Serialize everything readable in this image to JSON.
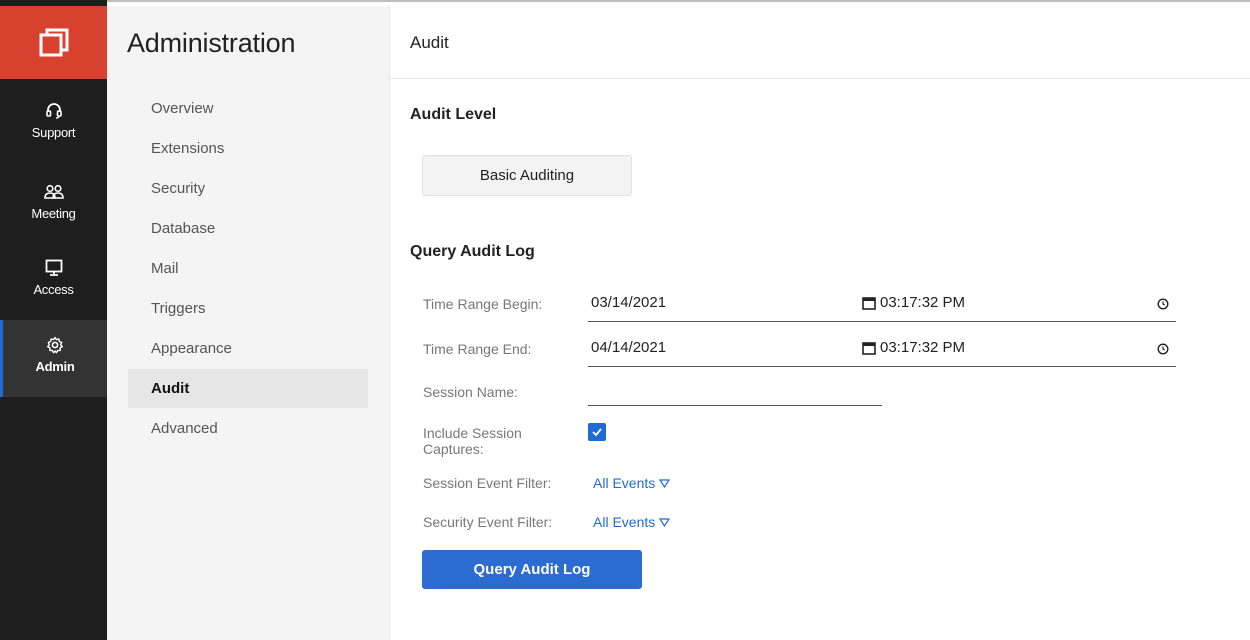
{
  "rail": {
    "items": [
      {
        "label": "Support",
        "icon": "headset-icon"
      },
      {
        "label": "Meeting",
        "icon": "people-icon"
      },
      {
        "label": "Access",
        "icon": "monitor-icon"
      },
      {
        "label": "Admin",
        "icon": "gear-icon",
        "active": true
      }
    ]
  },
  "nav": {
    "title": "Administration",
    "items": [
      {
        "label": "Overview"
      },
      {
        "label": "Extensions"
      },
      {
        "label": "Security"
      },
      {
        "label": "Database"
      },
      {
        "label": "Mail"
      },
      {
        "label": "Triggers"
      },
      {
        "label": "Appearance"
      },
      {
        "label": "Audit",
        "active": true
      },
      {
        "label": "Advanced"
      }
    ]
  },
  "header": {
    "title": "Audit"
  },
  "audit_level": {
    "heading": "Audit Level",
    "button_label": "Basic Auditing"
  },
  "query": {
    "heading": "Query Audit Log",
    "begin": {
      "label": "Time Range Begin:",
      "date": "03/14/2021",
      "time": "03:17:32 PM"
    },
    "end": {
      "label": "Time Range End:",
      "date": "04/14/2021",
      "time": "03:17:32 PM"
    },
    "session_name": {
      "label": "Session Name:",
      "value": ""
    },
    "include_captures": {
      "label": "Include Session Captures:",
      "checked": true
    },
    "session_filter": {
      "label": "Session Event Filter:",
      "value": "All Events"
    },
    "security_filter": {
      "label": "Security Event Filter:",
      "value": "All Events"
    },
    "button_label": "Query Audit Log"
  },
  "colors": {
    "accent": "#1e6bd6",
    "logo_bg": "#d9412f",
    "rail_bg": "#1e1e1e"
  }
}
